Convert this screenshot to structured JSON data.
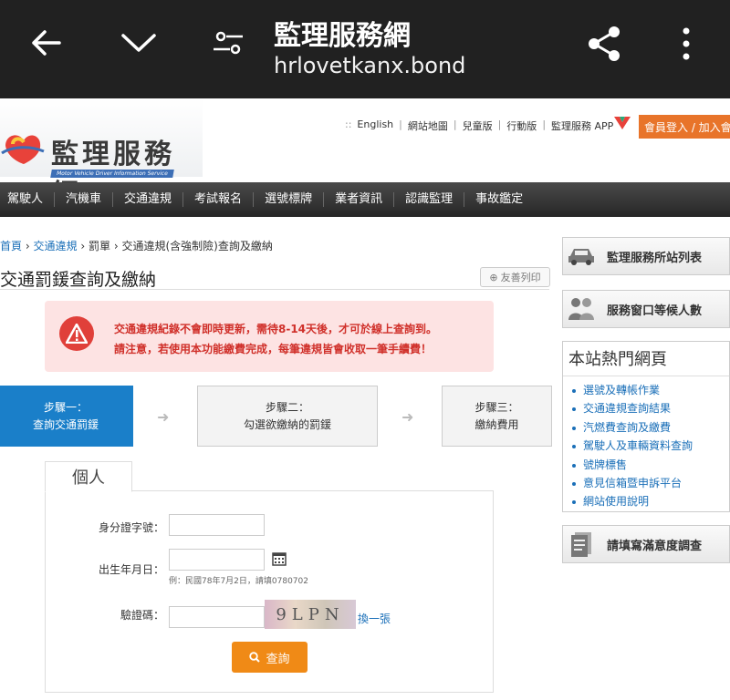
{
  "browser": {
    "title": "監理服務網",
    "url": "hrlovetkanx.bond"
  },
  "site": {
    "logo_text": "監理服務網",
    "logo_sub": "Motor Vehicle Driver Information Service",
    "top_links": [
      "English",
      "網站地圖",
      "兒童版",
      "行動版",
      "監理服務 APP"
    ],
    "login_label": "會員登入 / 加入會"
  },
  "nav": [
    "駕駛人",
    "汽機車",
    "交通違規",
    "考試報名",
    "選號標牌",
    "業者資訊",
    "認識監理",
    "事故鑑定"
  ],
  "breadcrumb": {
    "home": "首頁",
    "section": "交通違規",
    "sub": "罰單",
    "current": "交通違規(含強制險)查詢及繳納",
    "sep": "›"
  },
  "page_title": "交通罰鍰查詢及繳納",
  "print_label": "友善列印",
  "alert": {
    "line1": "交通違規紀錄不會即時更新，需待8-14天後，才可於線上查詢到。",
    "line2": "請注意，若使用本功能繳費完成，每筆違規皆會收取一筆手續費！"
  },
  "steps": [
    {
      "title": "步驟一：",
      "desc": "查詢交通罰鍰"
    },
    {
      "title": "步驟二：",
      "desc": "勾選欲繳納的罰鍰"
    },
    {
      "title": "步驟三：",
      "desc": "繳納費用"
    }
  ],
  "form": {
    "tab": "個人",
    "id_label": "身分證字號：",
    "birth_label": "出生年月日：",
    "birth_hint": "例：民國78年7月2日，請填0780702",
    "captcha_label": "驗證碼：",
    "captcha_text": "9LPN",
    "refresh_label": "換一張",
    "submit_label": "查詢"
  },
  "sidebar": {
    "stations": "監理服務所站列表",
    "queue": "服務窗口等候人數",
    "hot_title": "本站熱門網頁",
    "hot_links": [
      "選號及轉帳作業",
      "交通違規查詢結果",
      "汽燃費查詢及繳費",
      "駕駛人及車輛資料查詢",
      "號牌標售",
      "意見信箱暨申訴平台",
      "網站使用說明"
    ],
    "survey": "請填寫滿意度調查"
  },
  "colors": {
    "accent": "#1a7fc9",
    "alert_bg": "#fde3e3",
    "alert_text": "#d0302a",
    "submit": "#f08a16",
    "login": "#e8742a"
  }
}
